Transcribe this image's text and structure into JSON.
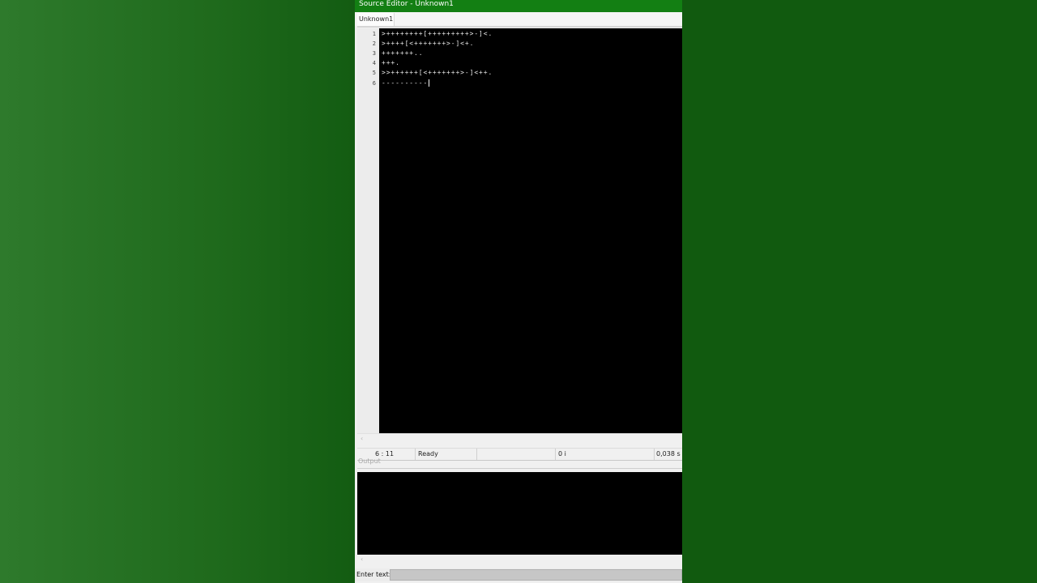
{
  "window": {
    "title": "Source Editor - Unknown1"
  },
  "tabs": [
    {
      "label": "Unknown1"
    }
  ],
  "editor": {
    "lines": [
      {
        "number": "1",
        "text": ">++++++++[+++++++++>-]<."
      },
      {
        "number": "2",
        "text": ">++++[<+++++++>-]<+."
      },
      {
        "number": "3",
        "text": "+++++++.."
      },
      {
        "number": "4",
        "text": "+++."
      },
      {
        "number": "5",
        "text": ">>++++++[<+++++++>-]<++."
      },
      {
        "number": "6",
        "text": "----------"
      }
    ]
  },
  "statusbar": {
    "position": "6 : 11",
    "state": "Ready",
    "instructions": "0 i",
    "time": "0,038 s"
  },
  "output": {
    "label": "Output"
  },
  "input": {
    "label": "Enter text:",
    "value": ""
  },
  "icons": {
    "scroll_left": "chevron-left-icon"
  },
  "colors": {
    "titlebar": "#137f13",
    "background_left": "#2e7a2c",
    "background_right": "#115a0f",
    "editor_bg": "#000000",
    "code_text": "#e6e6e6"
  }
}
